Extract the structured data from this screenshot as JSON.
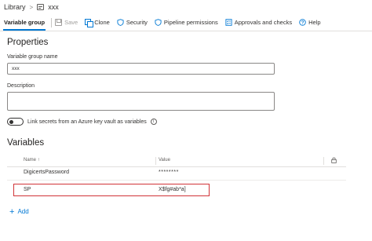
{
  "breadcrumb": {
    "root": "Library",
    "separator": ">",
    "current": "xxx"
  },
  "toolbar": {
    "active_tab": "Variable group",
    "save": "Save",
    "clone": "Clone",
    "security": "Security",
    "pipeline_permissions": "Pipeline permissions",
    "approvals": "Approvals and checks",
    "help": "Help"
  },
  "properties": {
    "title": "Properties",
    "name_label": "Variable group name",
    "name_value": "xxx",
    "description_label": "Description",
    "description_value": "",
    "keyvault_toggle_label": "Link secrets from an Azure key vault as variables",
    "keyvault_toggle_on": false,
    "info_glyph": "i"
  },
  "variables": {
    "title": "Variables",
    "columns": {
      "name": "Name",
      "sort_glyph": "↑",
      "value": "Value"
    },
    "rows": [
      {
        "name": "DigicertsPassword",
        "value": "********"
      },
      {
        "name": "SP",
        "value": "X$fg#ab*a]"
      }
    ],
    "add_label": "Add"
  },
  "colors": {
    "accent": "#0078d4",
    "highlight_border": "#d13438"
  },
  "icons": {
    "save": "save-icon",
    "clone": "clone-icon",
    "security": "shield-icon",
    "pipeline_permissions": "shield-icon",
    "approvals": "checklist-icon",
    "help": "help-icon",
    "lock": "lock-icon"
  }
}
